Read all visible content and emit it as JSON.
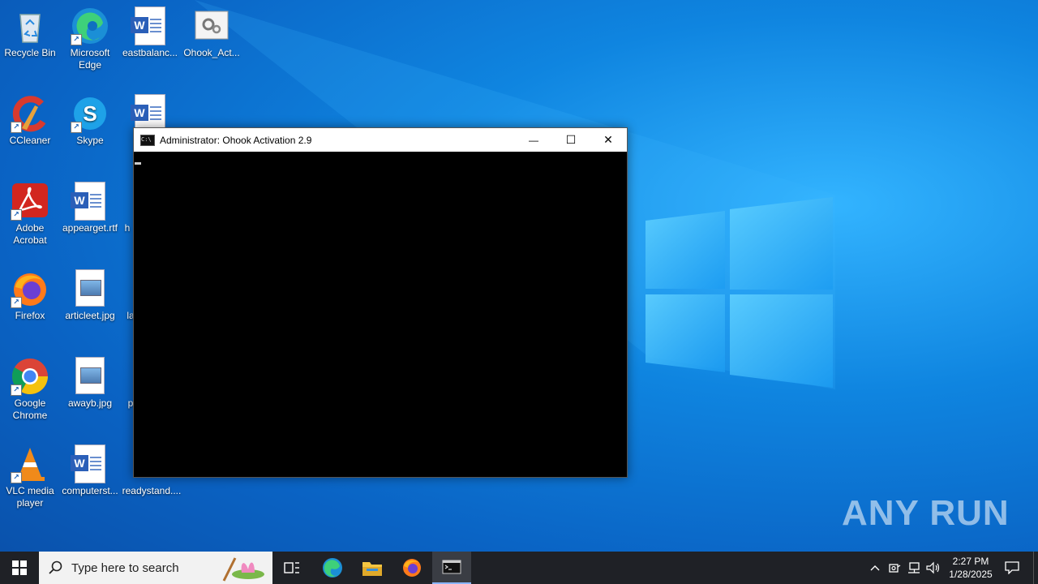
{
  "desktop": {
    "icons": [
      {
        "label": "Recycle Bin"
      },
      {
        "label": "Microsoft Edge"
      },
      {
        "label": "eastbalanc..."
      },
      {
        "label": "Ohook_Act..."
      },
      {
        "label": "CCleaner"
      },
      {
        "label": "Skype"
      },
      {
        "label": "Adobe Acrobat"
      },
      {
        "label": "appearget.rtf"
      },
      {
        "label": "h"
      },
      {
        "label": "Firefox"
      },
      {
        "label": "articleet.jpg"
      },
      {
        "label": "la"
      },
      {
        "label": "Google Chrome"
      },
      {
        "label": "awayb.jpg"
      },
      {
        "label": "p"
      },
      {
        "label": "VLC media player"
      },
      {
        "label": "computerst..."
      },
      {
        "label": "readystand...."
      }
    ]
  },
  "cmd_window": {
    "title": "Administrator:  Ohook Activation 2.9",
    "minimize": "—",
    "maximize": "☐",
    "close": "✕"
  },
  "taskbar": {
    "search_placeholder": "Type here to search",
    "clock_time": "2:27 PM",
    "clock_date": "1/28/2025"
  },
  "watermark": "ANY RUN",
  "colors": {
    "desktop_bg": "#0f85e0",
    "taskbar_bg": "#1f2126",
    "console_bg": "#000000"
  }
}
